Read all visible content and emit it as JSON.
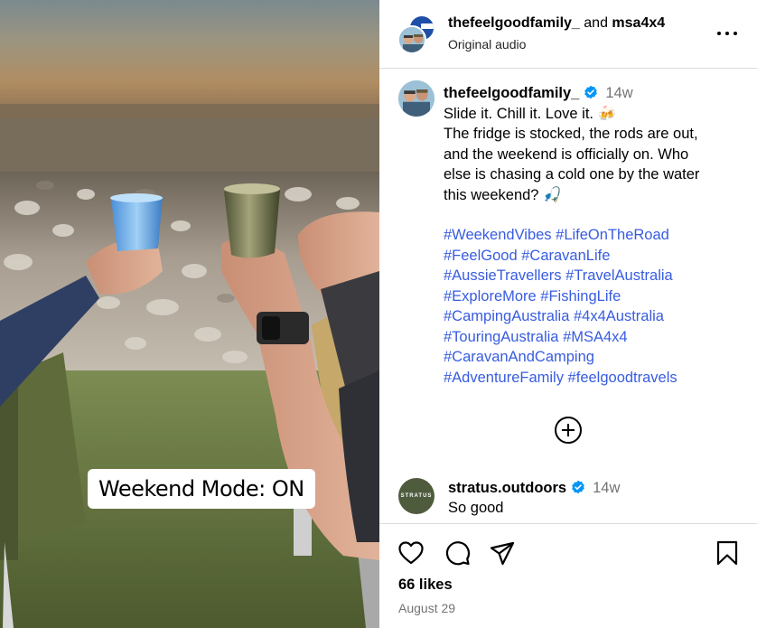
{
  "header": {
    "user1": "thefeelgoodfamily_",
    "joiner": "and",
    "user2": "msa4x4",
    "audio": "Original audio"
  },
  "media": {
    "overlay_text": "Weekend Mode: ON"
  },
  "caption": {
    "username": "thefeelgoodfamily_",
    "time": "14w",
    "lines": [
      "Slide it. Chill it. Love it. 🍻",
      "The fridge is stocked, the rods are out,",
      "and the weekend is officially on. Who",
      "else is chasing a cold one by the water",
      "this weekend? 🎣"
    ],
    "hashtag_lines": [
      "#WeekendVibes #LifeOnTheRoad",
      "#FeelGood #CaravanLife",
      "#AussieTravellers #TravelAustralia",
      "#ExploreMore #FishingLife",
      "#CampingAustralia #4x4Australia",
      "#TouringAustralia #MSA4x4",
      "#CaravanAndCamping",
      "#AdventureFamily #feelgoodtravels"
    ]
  },
  "comment": {
    "username": "stratus.outdoors",
    "time": "14w",
    "text": "So good",
    "avatar_text": "STRATUS"
  },
  "footer": {
    "likes": "66 likes",
    "date": "August 29"
  },
  "icons": [
    "more-icon",
    "verified-icon",
    "add-comment-icon",
    "heart-icon",
    "comment-icon",
    "share-icon",
    "bookmark-icon"
  ],
  "colors": {
    "hashtag": "#385ce0",
    "verified": "#0095f6",
    "muted": "#737373",
    "divider": "#dbdbdb"
  }
}
